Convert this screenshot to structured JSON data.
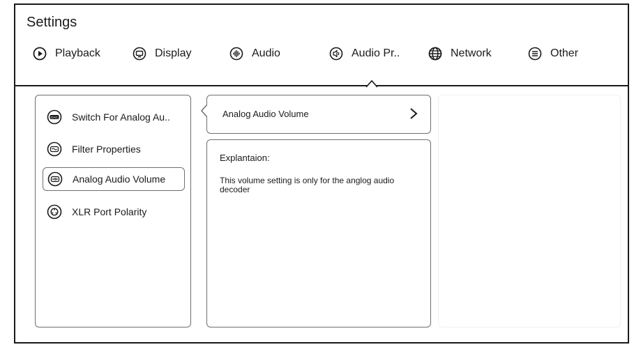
{
  "header": {
    "title": "Settings",
    "tabs": [
      {
        "label": "Playback",
        "icon": "play-circle-icon"
      },
      {
        "label": "Display",
        "icon": "display-icon"
      },
      {
        "label": "Audio",
        "icon": "audio-waveform-icon"
      },
      {
        "label": "Audio Pr..",
        "icon": "speaker-icon",
        "selected": true
      },
      {
        "label": "Network",
        "icon": "globe-icon"
      },
      {
        "label": "Other",
        "icon": "list-circle-icon"
      }
    ]
  },
  "menu": {
    "items": [
      {
        "label": "Switch For Analog Au..",
        "icon": "dac-icon"
      },
      {
        "label": "Filter Properties",
        "icon": "filter-icon"
      },
      {
        "label": "Analog Audio Volume",
        "icon": "volume-level-icon",
        "selected": true
      },
      {
        "label": "XLR Port Polarity",
        "icon": "polarity-icon"
      }
    ]
  },
  "detail": {
    "option_label": "Analog Audio Volume",
    "explanation_title": "Explantaion:",
    "explanation_text": "This volume setting is only for the anglog audio decoder"
  },
  "colors": {
    "border": "#1a1a1a",
    "panel_border": "#6f6f6f",
    "text": "#1a1a1a",
    "background": "#ffffff"
  }
}
